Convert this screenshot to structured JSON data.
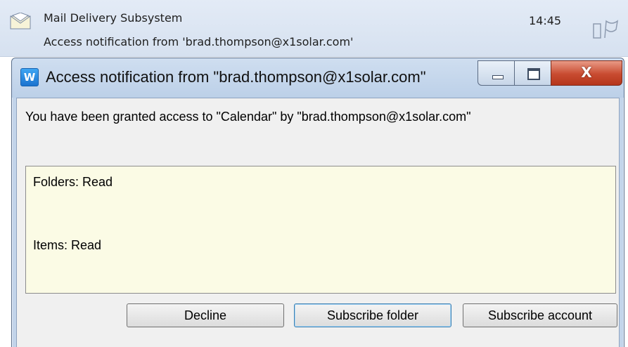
{
  "mail_item": {
    "sender": "Mail Delivery Subsystem",
    "subject": "Access notification from 'brad.thompson@x1solar.com'",
    "time": "14:45",
    "icon": "envelope-icon",
    "flag_icon": "flag-icon"
  },
  "dialog": {
    "app_icon_letter": "W",
    "title": "Access notification from \"brad.thompson@x1solar.com\"",
    "message": "You have been granted access to \"Calendar\" by \"brad.thompson@x1solar.com\"",
    "permissions": {
      "folders": "Folders: Read",
      "items": "Items: Read"
    },
    "buttons": {
      "decline": "Decline",
      "subscribe_folder": "Subscribe folder",
      "subscribe_account": "Subscribe account"
    },
    "close_glyph": "X"
  },
  "colors": {
    "list_background": "#d6e1f0",
    "dialog_frame": "#c2d4ea",
    "permission_box": "#fbfbe5",
    "close_button": "#c84b30"
  }
}
